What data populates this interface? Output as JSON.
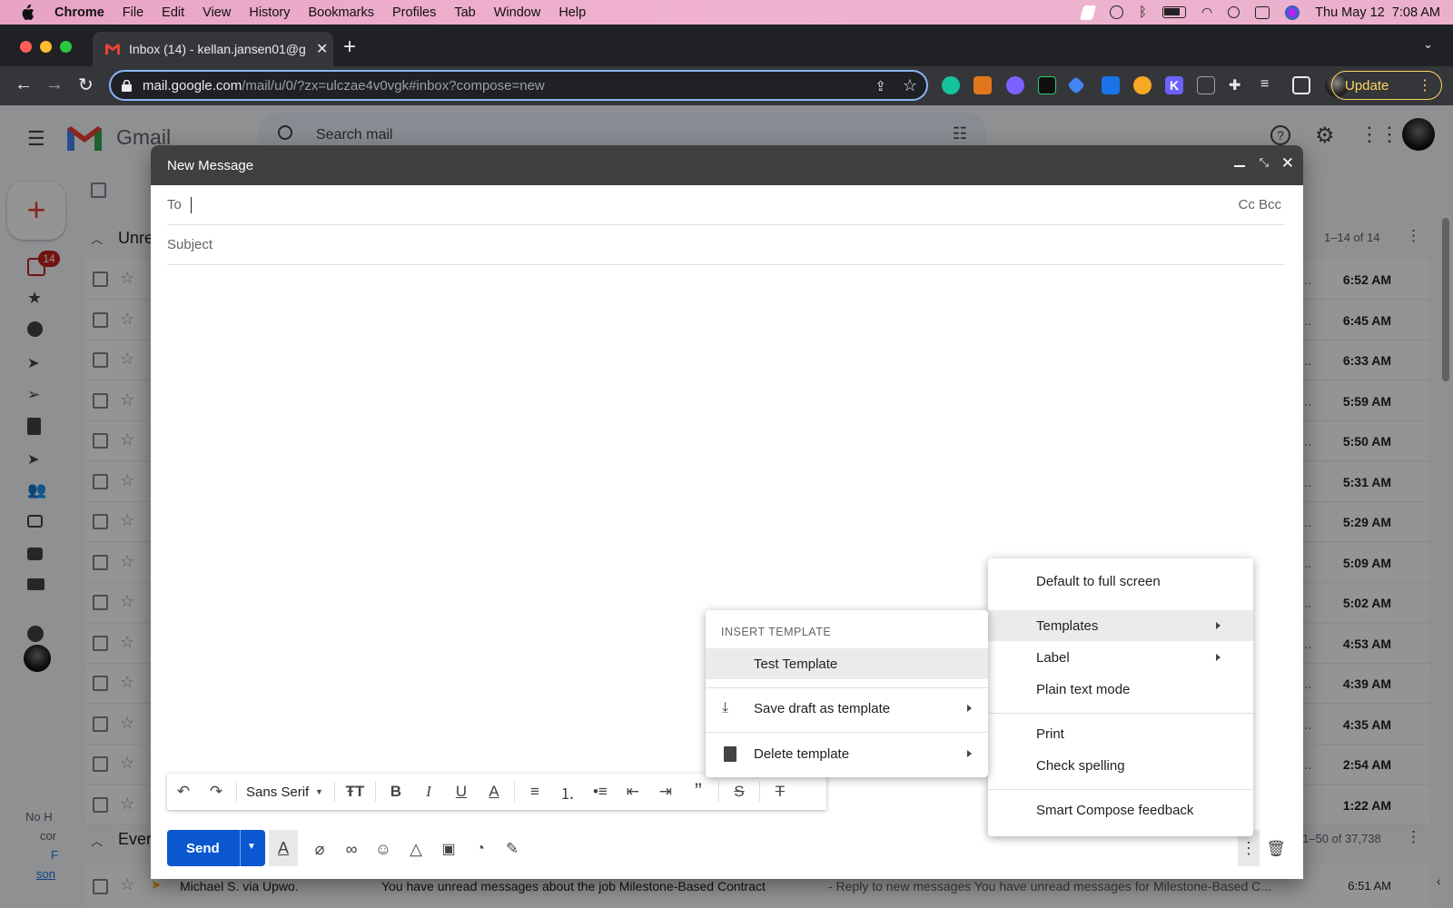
{
  "menubar": {
    "app": "Chrome",
    "items": [
      "File",
      "Edit",
      "View",
      "History",
      "Bookmarks",
      "Profiles",
      "Tab",
      "Window",
      "Help"
    ],
    "clock": "Thu May 12  7:08 AM"
  },
  "browser": {
    "tab_title": "Inbox (14) - kellan.jansen01@g",
    "url_host": "mail.google.com",
    "url_path": "/mail/u/0/?zx=ulczae4v0vgk#inbox?compose=new",
    "update_label": "Update"
  },
  "gmail": {
    "logo": "Gmail",
    "search_placeholder": "Search mail",
    "inbox_badge": "14",
    "section_unread": "Unre",
    "section_everything": "Ever",
    "pagination_unread": "1–14 of 14",
    "pagination_all": "1–50 of 37,738",
    "rows": [
      {
        "snip": "ep...",
        "time": "6:52 AM"
      },
      {
        "snip": "he...",
        "time": "6:45 AM"
      },
      {
        "snip": "A ...",
        "time": "6:33 AM"
      },
      {
        "snip": "o ...",
        "time": "5:59 AM"
      },
      {
        "snip": "ce ...",
        "time": "5:50 AM"
      },
      {
        "snip": "r...",
        "time": "5:31 AM"
      },
      {
        "snip": "n...",
        "time": "5:29 AM"
      },
      {
        "snip": "ar...",
        "time": "5:09 AM"
      },
      {
        "snip": "an...",
        "time": "5:02 AM"
      },
      {
        "snip": "g ...",
        "time": "4:53 AM"
      },
      {
        "snip": "C...",
        "time": "4:39 AM"
      },
      {
        "snip": "h ...",
        "time": "4:35 AM"
      },
      {
        "snip": "ir...",
        "time": "2:54 AM"
      },
      {
        "snip": "",
        "time": "1:22 AM"
      }
    ],
    "left_hint_1": "No H",
    "left_hint_2": "cor",
    "left_hint_3": "F",
    "left_hint_4": "son",
    "bottom_row": {
      "sender": "Michael S. via Upwo.",
      "subject": "You have unread messages about the job Milestone-Based Contract",
      "preview": " - Reply to new messages You have unread messages for Milestone-Based C...",
      "time": "6:51 AM"
    }
  },
  "compose": {
    "title": "New Message",
    "to_label": "To",
    "cc_bcc": "Cc Bcc",
    "subject_placeholder": "Subject",
    "font": "Sans Serif",
    "send_label": "Send"
  },
  "more_menu": {
    "items": [
      "Default to full screen",
      "Templates",
      "Label",
      "Plain text mode",
      "Print",
      "Check spelling",
      "Smart Compose feedback"
    ]
  },
  "template_menu": {
    "header": "INSERT TEMPLATE",
    "template_item": "Test Template",
    "save_draft": "Save draft as template",
    "delete": "Delete template"
  }
}
